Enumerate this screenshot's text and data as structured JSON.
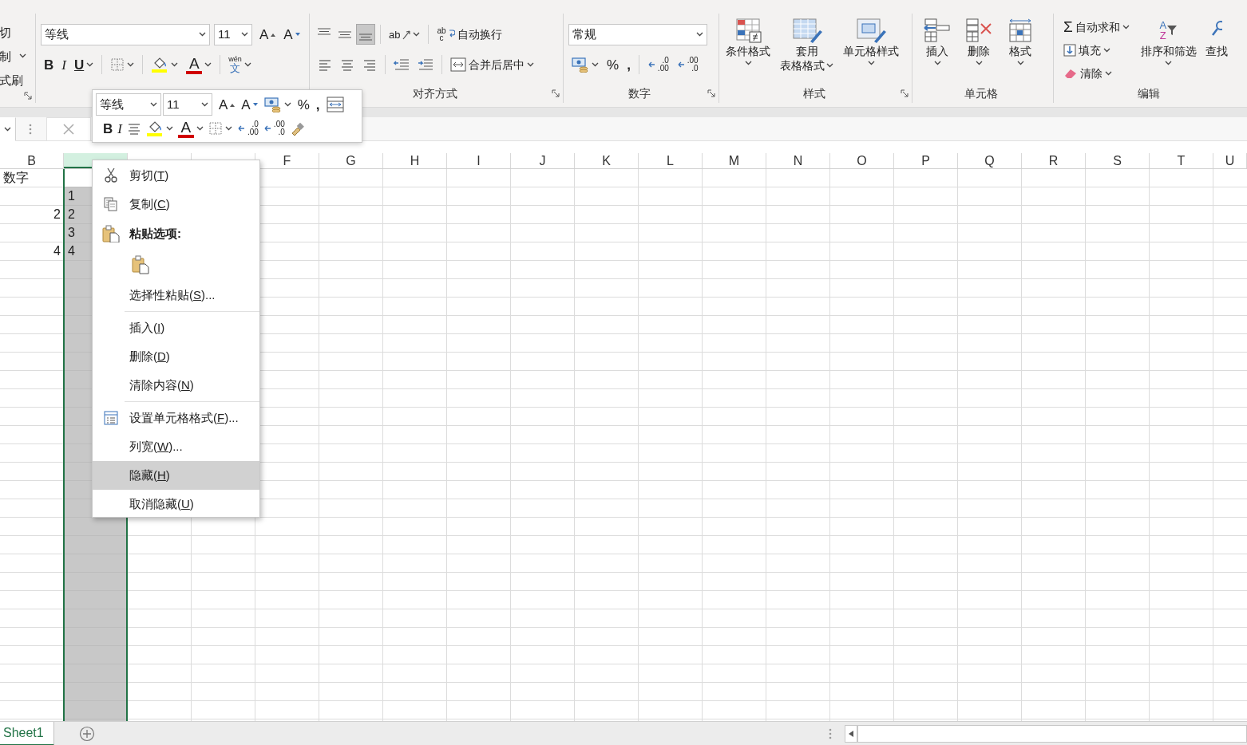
{
  "clipboard_group": {
    "buttons": [
      {
        "label": "切",
        "dropdown": false
      },
      {
        "label": "制",
        "dropdown": true
      },
      {
        "label": "式刷",
        "dropdown": false
      }
    ]
  },
  "font_group": {
    "font_name": "等线",
    "font_size": "11",
    "grow_glyph": "A",
    "shrink_glyph": "A",
    "bold": "B",
    "italic": "I",
    "underline": "U",
    "font_color_glyph": "A",
    "phonetic_glyphs": [
      "wén",
      "文"
    ]
  },
  "alignment_group": {
    "label": "对齐方式",
    "vertical_align": [
      {
        "selected": false
      },
      {
        "selected": false
      },
      {
        "selected": true
      }
    ],
    "orientation_glyph": "ab",
    "wrap_glyphs": [
      "ab",
      "c"
    ],
    "wrap_text": "自动换行",
    "merge_center": "合并后居中"
  },
  "number_group": {
    "label": "数字",
    "format": "常规",
    "percent": "%",
    "comma": ",",
    "increase_decimal": [
      ".0",
      ".00"
    ],
    "decrease_decimal": [
      ".00",
      ".0"
    ]
  },
  "styles_group": {
    "label": "样式",
    "buttons": [
      {
        "lines": [
          "条件格式"
        ]
      },
      {
        "lines": [
          "套用",
          "表格格式"
        ]
      },
      {
        "lines": [
          "单元格样式"
        ]
      }
    ]
  },
  "cells_group": {
    "label": "单元格",
    "buttons": [
      "插入",
      "删除",
      "格式"
    ]
  },
  "editing_group": {
    "label": "编辑",
    "autosum_glyph": "Σ",
    "small_buttons": [
      "自动求和",
      "填充",
      "清除"
    ],
    "sort_glyphs": [
      "A",
      "Z"
    ],
    "sort_filter": "排序和筛选",
    "find": "查找"
  },
  "mini_toolbar": {
    "font_name": "等线",
    "font_size": "11",
    "grow_glyph": "A",
    "shrink_glyph": "A",
    "percent": "%",
    "comma": ",",
    "bold": "B",
    "italic": "I",
    "font_color_glyph": "A",
    "increase_decimal": [
      ".0",
      ".00"
    ],
    "decrease_decimal": [
      ".00",
      ".0"
    ]
  },
  "sheet": {
    "columns": [
      {
        "label": "B",
        "selected": false
      },
      {
        "selected": true
      },
      {
        "selected": false
      },
      {
        "selected": false
      },
      {
        "label": "F",
        "selected": false
      },
      {
        "label": "G",
        "selected": false
      },
      {
        "label": "H",
        "selected": false
      },
      {
        "label": "I",
        "selected": false
      },
      {
        "label": "J",
        "selected": false
      },
      {
        "label": "K",
        "selected": false
      },
      {
        "label": "L",
        "selected": false
      },
      {
        "label": "M",
        "selected": false
      },
      {
        "label": "N",
        "selected": false
      },
      {
        "label": "O",
        "selected": false
      },
      {
        "label": "P",
        "selected": false
      },
      {
        "label": "Q",
        "selected": false
      },
      {
        "label": "R",
        "selected": false
      },
      {
        "label": "S",
        "selected": false
      },
      {
        "label": "T",
        "selected": false
      },
      {
        "label": "U",
        "selected": false
      }
    ],
    "rows": [
      {
        "column_b": {
          "text": "数字",
          "right_aligned": false
        },
        "c_active": true
      },
      {
        "column_c": {
          "text": "1",
          "right_aligned": false
        },
        "c_active": false
      },
      {
        "column_b": {
          "text": "2",
          "right_aligned": true
        },
        "column_c": {
          "text": "2",
          "right_aligned": false
        },
        "c_active": false
      },
      {
        "column_c": {
          "text": "3",
          "right_aligned": false
        },
        "c_active": false
      },
      {
        "column_b": {
          "text": "4",
          "right_aligned": true
        },
        "column_c": {
          "text": "4",
          "right_aligned": false
        },
        "c_active": false
      }
    ]
  },
  "context_menu": {
    "items": [
      {
        "kind": "command",
        "has_icon": true,
        "text": "剪切(",
        "key": "T",
        "tail": ")",
        "selected": false
      },
      {
        "kind": "command",
        "has_icon": true,
        "text": "复制(",
        "key": "C",
        "tail": ")",
        "selected": false
      },
      {
        "kind": "header",
        "has_icon": true,
        "text": "粘贴选项:",
        "selected": false
      },
      {
        "kind": "paste_option",
        "selected": false
      },
      {
        "kind": "command",
        "has_icon": false,
        "text": "选择性粘贴(",
        "key": "S",
        "tail": ")...",
        "selected": false
      },
      {
        "kind": "separator"
      },
      {
        "kind": "command",
        "has_icon": false,
        "text": "插入(",
        "key": "I",
        "tail": ")",
        "selected": false
      },
      {
        "kind": "command",
        "has_icon": false,
        "text": "删除(",
        "key": "D",
        "tail": ")",
        "selected": false
      },
      {
        "kind": "command",
        "has_icon": false,
        "text": "清除内容(",
        "key": "N",
        "tail": ")",
        "selected": false
      },
      {
        "kind": "separator"
      },
      {
        "kind": "command",
        "has_icon": true,
        "text": "设置单元格格式(",
        "key": "F",
        "tail": ")...",
        "selected": false
      },
      {
        "kind": "command",
        "has_icon": false,
        "text": "列宽(",
        "key": "W",
        "tail": ")...",
        "selected": false
      },
      {
        "kind": "command",
        "has_icon": false,
        "text": "隐藏(",
        "key": "H",
        "tail": ")",
        "selected": true
      },
      {
        "kind": "command",
        "has_icon": false,
        "text": "取消隐藏(",
        "key": "U",
        "tail": ")",
        "selected": false
      }
    ]
  },
  "sheet_tabs": [
    {
      "label": "Sheet1",
      "selected": true
    }
  ]
}
